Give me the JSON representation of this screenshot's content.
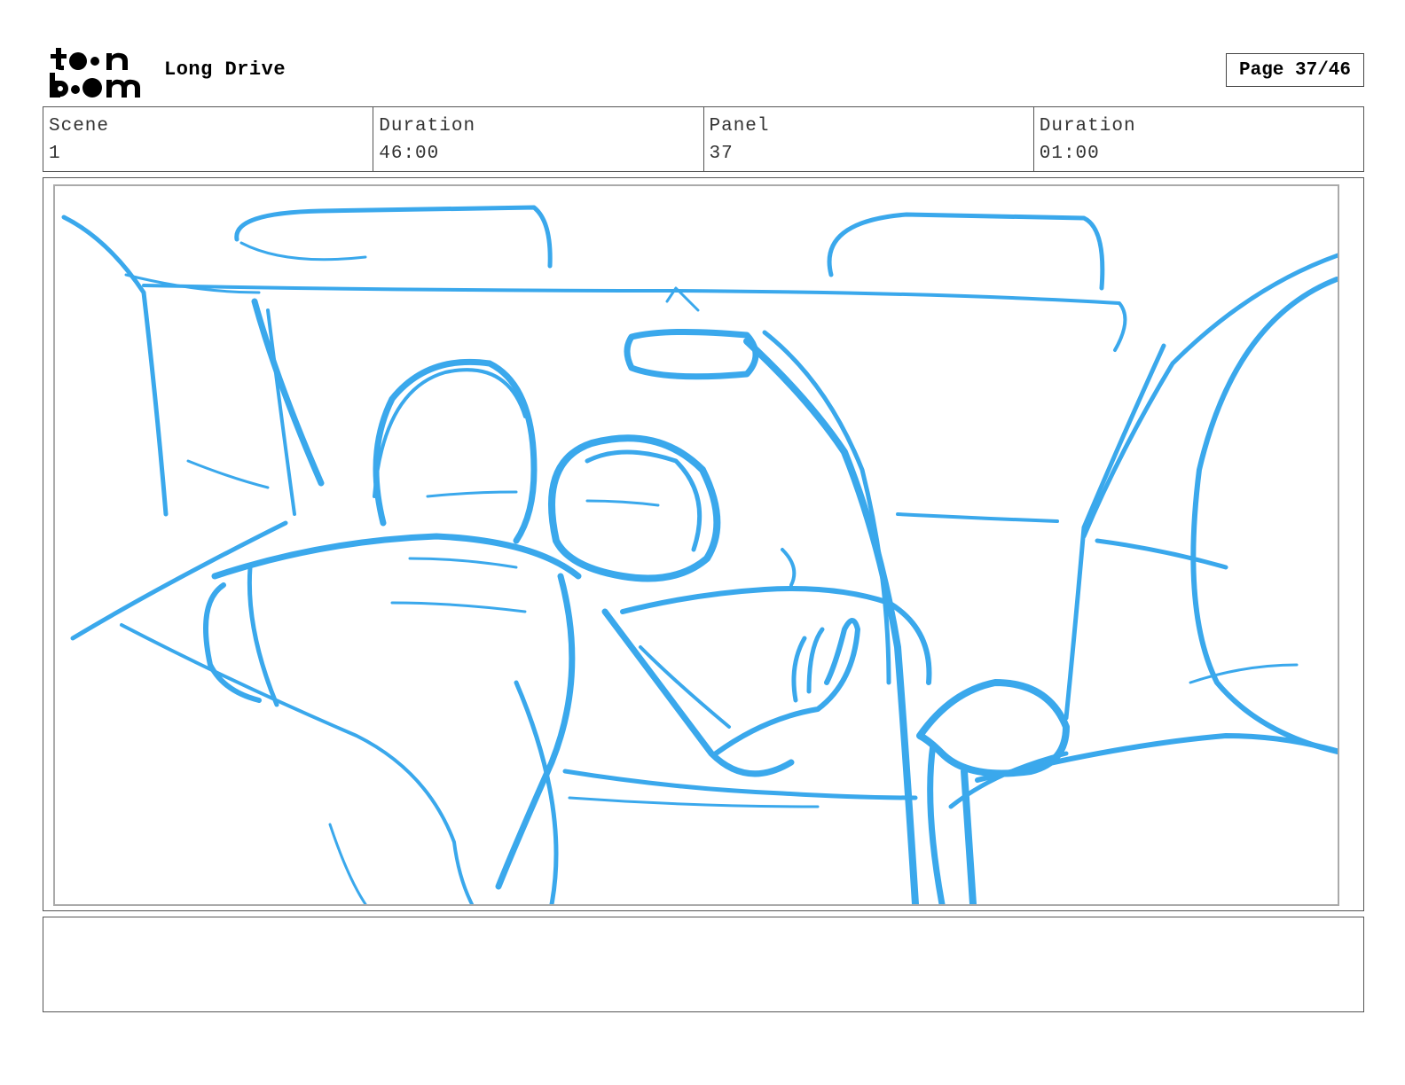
{
  "header": {
    "logo_text": "toon boom",
    "project_title": "Long Drive",
    "page_label": "Page 37/46"
  },
  "info": {
    "scene_label": "Scene",
    "scene_value": "1",
    "scene_duration_label": "Duration",
    "scene_duration_value": "46:00",
    "panel_label": "Panel",
    "panel_value": "37",
    "panel_duration_label": "Duration",
    "panel_duration_value": "01:00"
  },
  "panel": {
    "sketch_color": "#3aa8ec",
    "frame_color": "#aaaaaa"
  },
  "notes": {
    "text": ""
  }
}
